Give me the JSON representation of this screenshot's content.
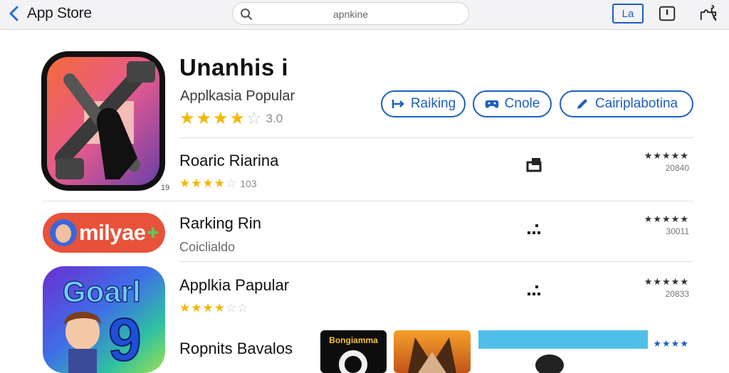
{
  "topbar": {
    "back_label": "App Store",
    "search_placeholder": "apnkine",
    "lang_button": "La"
  },
  "hero": {
    "title": "Unanhis i",
    "subtitle": "Applkasia Popular",
    "stars": 4,
    "rating": "3.0",
    "badge": "19",
    "pills": [
      {
        "label": "Raiking",
        "icon": "ranking-icon"
      },
      {
        "label": "Cnole",
        "icon": "controller-icon"
      },
      {
        "label": "Cairiplabotina",
        "icon": "pencil-icon"
      }
    ]
  },
  "rows": [
    {
      "title": "Roaric Riarina",
      "stars": 4,
      "rating": "103",
      "right_stars": "★★★★★",
      "right_num": "20840"
    },
    {
      "title": "Rarking Rin",
      "subtitle": "Coiclialdo",
      "right_stars": "★★★★★",
      "right_num": "30011"
    },
    {
      "title": "Applkia Papular",
      "stars": 4,
      "right_stars": "★★★★★",
      "right_num": "20833"
    },
    {
      "title": "Ropnits Bavalos",
      "right_stars": "★★★★"
    }
  ],
  "logos": {
    "pill_text": "milyae",
    "goal_text": "Goarl",
    "goal_num": "9",
    "thumb_label": "Bongiamma"
  },
  "colors": {
    "accent": "#1d5fbf",
    "star": "#f3b704",
    "logo_red": "#e9523a"
  }
}
